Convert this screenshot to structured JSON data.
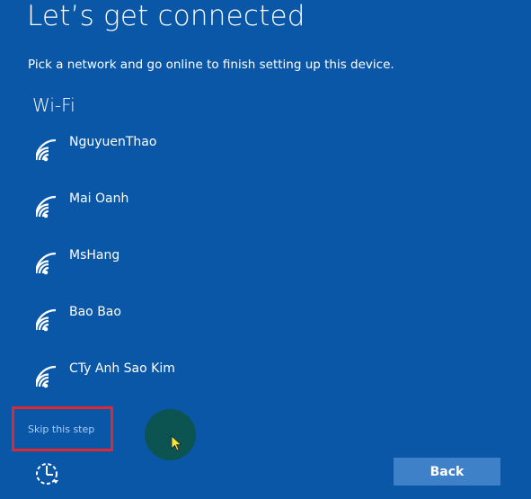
{
  "page": {
    "title": "Let’s get connected",
    "subtitle": "Pick a network and go online to finish setting up this device."
  },
  "wifi": {
    "section_label": "Wi-Fi",
    "networks": [
      {
        "name": "NguyuenThao",
        "icon": "wifi-signal-icon"
      },
      {
        "name": "Mai Oanh",
        "icon": "wifi-signal-icon"
      },
      {
        "name": "MsHang",
        "icon": "wifi-signal-icon"
      },
      {
        "name": "Bao Bao",
        "icon": "wifi-signal-icon"
      },
      {
        "name": "CTy Anh Sao Kim",
        "icon": "wifi-signal-icon"
      }
    ]
  },
  "footer": {
    "skip_label": "Skip this step",
    "back_label": "Back",
    "accessibility_icon": "ease-of-access-icon"
  },
  "colors": {
    "background": "#0a57a8",
    "button": "#3f81c9",
    "skip_link": "#a9cff6",
    "highlight_border": "#e0282e",
    "cursor_halo": "#0b5452"
  }
}
